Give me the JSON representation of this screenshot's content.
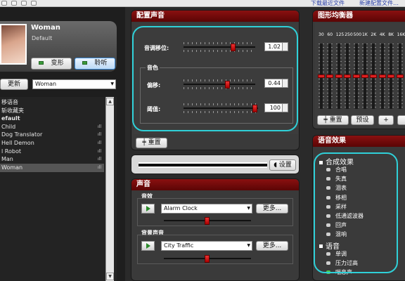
{
  "left": {
    "profile": {
      "name": "Woman",
      "preset": "Default"
    },
    "buttons": {
      "morph": "变形",
      "listen": "聆听",
      "update": "更新"
    },
    "voice_select": "Woman",
    "list": [
      {
        "label": "移语音",
        "bold": false,
        "selected": false,
        "signal": false
      },
      {
        "label": "斩收藏夹",
        "bold": false,
        "selected": false,
        "signal": false
      },
      {
        "label": "efault",
        "bold": true,
        "selected": false,
        "signal": false
      },
      {
        "label": "Child",
        "bold": false,
        "selected": false,
        "signal": true
      },
      {
        "label": "Dog Translator",
        "bold": false,
        "selected": false,
        "signal": true
      },
      {
        "label": "Hell Demon",
        "bold": false,
        "selected": false,
        "signal": true
      },
      {
        "label": "l Robot",
        "bold": false,
        "selected": false,
        "signal": true
      },
      {
        "label": "Man",
        "bold": false,
        "selected": false,
        "signal": true
      },
      {
        "label": "Woman",
        "bold": false,
        "selected": true,
        "signal": true
      }
    ],
    "signal_glyph": "ıll"
  },
  "top_strip": {
    "link1": "下载最近文件",
    "link2": "新建配置文件…"
  },
  "voice_config": {
    "title": "配置声音",
    "pitch_label": "音调移位:",
    "pitch_value": "1.02",
    "pitch_level": 0.71,
    "timbre_group": "音色",
    "offset_label": "偏移:",
    "offset_value": "0.44",
    "offset_level": 0.63,
    "threshold_label": "阈值:",
    "threshold_value": "100",
    "threshold_level": 1.0,
    "reset_label": "重置"
  },
  "output": {
    "setup_label": "设置"
  },
  "sound": {
    "title": "声音",
    "effects_label": "音效",
    "effect_select": "Alarm Clock",
    "more_label": "更多...",
    "effect_level": 0.5,
    "background_label": "背景声音",
    "background_select": "City Traffic",
    "background_level": 0.5
  },
  "equalizer": {
    "title": "图形均衡器",
    "bands": [
      "30",
      "60",
      "125",
      "250",
      "500",
      "1K",
      "2K",
      "4K",
      "8K",
      "16K"
    ],
    "levels": [
      0.5,
      0.5,
      0.5,
      0.5,
      0.5,
      0.5,
      0.5,
      0.5,
      0.5,
      0.5
    ],
    "reset_label": "重置",
    "preset_label": "预设",
    "plus_label": "+"
  },
  "voice_effects": {
    "title": "语音效果",
    "groups": [
      {
        "label": "合成效果",
        "items": [
          "合唱",
          "失真",
          "泪表",
          "移相",
          "采样",
          "低通滤波器",
          "回声",
          "混响"
        ],
        "active": []
      },
      {
        "label": "语音",
        "items": [
          "单调",
          "压力过高",
          "喘息声"
        ],
        "active": [
          "喘息声"
        ]
      }
    ]
  },
  "colors": {
    "header_red": "#7a0808",
    "highlight": "#2fd0d8",
    "knob_red": "#d22222"
  }
}
